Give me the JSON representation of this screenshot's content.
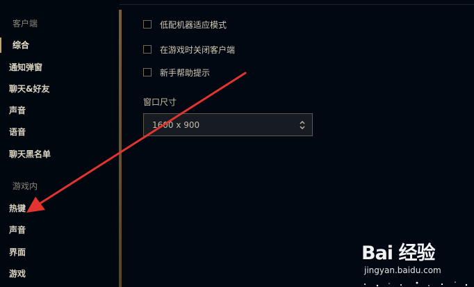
{
  "sidebar": {
    "section_client": "客户端",
    "client_items": [
      {
        "label": "综合",
        "active": true
      },
      {
        "label": "通知弹窗"
      },
      {
        "label": "聊天&好友"
      },
      {
        "label": "声音"
      },
      {
        "label": "语音"
      },
      {
        "label": "聊天黑名单"
      }
    ],
    "section_ingame": "游戏内",
    "ingame_items": [
      {
        "label": "热键"
      },
      {
        "label": "声音"
      },
      {
        "label": "界面"
      },
      {
        "label": "游戏"
      }
    ]
  },
  "options": {
    "low_spec": {
      "label": "低配机器适应模式",
      "checked": false
    },
    "close_client": {
      "label": "在游戏时关闭客户端",
      "checked": false
    },
    "tips": {
      "label": "新手帮助提示",
      "checked": false
    }
  },
  "window_size": {
    "label": "窗口尺寸",
    "value": "1600 x 900"
  },
  "watermark": {
    "logo": "Bai 经验",
    "url": "jingyan.baidu.com"
  },
  "colors": {
    "background": "#020812",
    "accent_gold": "#c8a45f",
    "arrow_red": "#e3342f"
  }
}
